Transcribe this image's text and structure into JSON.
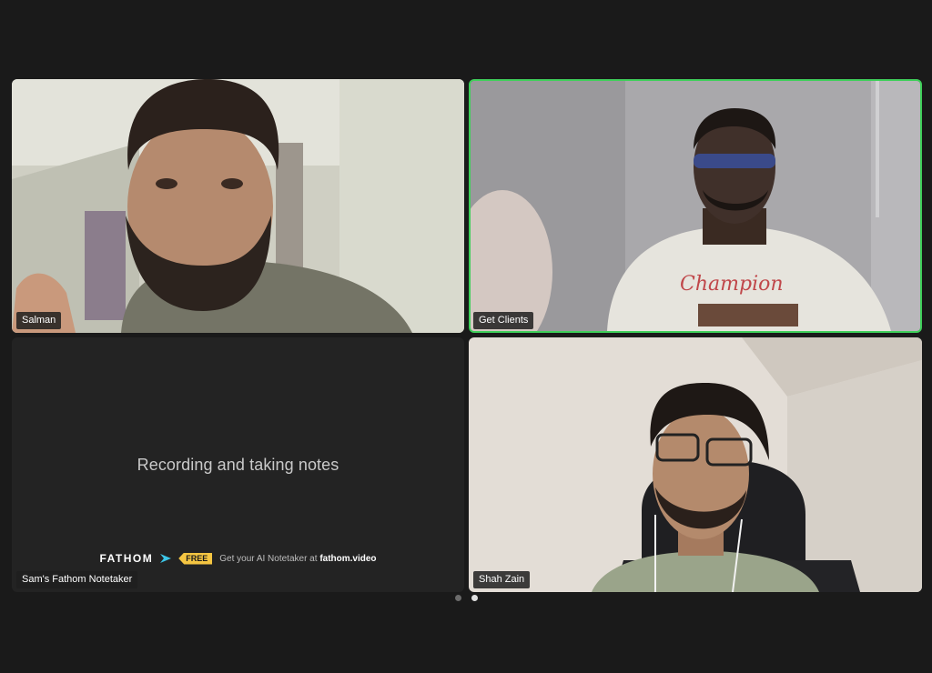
{
  "participants": [
    {
      "name": "Salman",
      "active_speaker": false
    },
    {
      "name": "Get Clients",
      "active_speaker": true
    },
    {
      "name": "Sam's Fathom Notetaker",
      "active_speaker": false
    },
    {
      "name": "Shah Zain",
      "active_speaker": false
    }
  ],
  "notetaker": {
    "status_text": "Recording and taking notes",
    "brand": "FATHOM",
    "badge": "FREE",
    "promo_text": "Get your AI Notetaker at",
    "promo_link": "fathom.video"
  },
  "pager": {
    "pages": 2,
    "current": 2
  },
  "colors": {
    "background": "#1a1a1a",
    "active_speaker_border": "#3fcf5a",
    "badge": "#f4c542"
  }
}
